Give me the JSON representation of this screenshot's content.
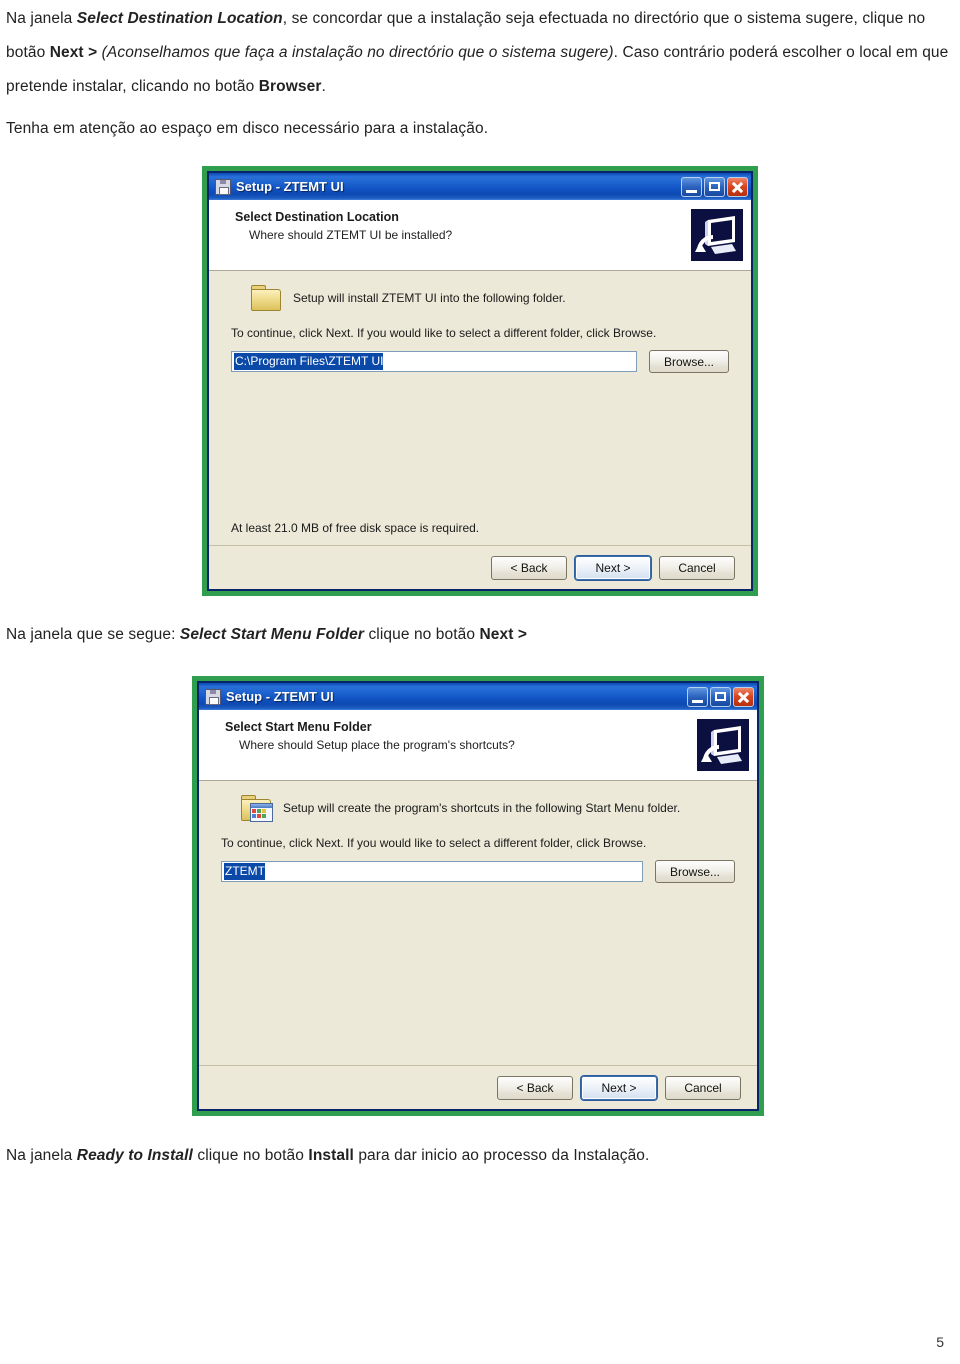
{
  "document": {
    "paragraphs": {
      "intro": {
        "s1": "Na janela ",
        "s2_bold_italic": "Select Destination Location",
        "s3": ", se concordar que a instalação seja efectuada no directório que o sistema sugere, clique no botão ",
        "s4_bold": "Next >",
        "s5_italic": " (Aconselhamos que faça a instalação no directório que o sistema sugere)",
        "s6": ". Caso contrário poderá escolher o local em que pretende instalar, clicando no botão ",
        "s7_bold": "Browser",
        "s8": "."
      },
      "disk": {
        "s1": "Tenha em atenção ao espaço em disco necessário para a instalação."
      },
      "menu": {
        "s1": "Na janela que se segue: ",
        "s2_bold_italic": "Select Start Menu Folder",
        "s3": "  clique no botão ",
        "s4_bold": "Next >"
      },
      "ready": {
        "s1": "Na janela  ",
        "s2_bold_italic": "Ready to Install",
        "s3": " clique no botão ",
        "s4_bold": "Install",
        "s5": " para dar inicio ao processo da Instalação."
      }
    },
    "page_number": "5"
  },
  "colors": {
    "capture_frame_green": "#2f9e4f",
    "window_border_navy": "#0a246a",
    "titlebar_blue": "#1153c4",
    "dialog_background": "#ece9d8",
    "selection_blue": "#0a49a8",
    "close_button_red": "#da4720",
    "header_art_navy": "#0b1040"
  },
  "dialogs": [
    {
      "id": "select-destination-location",
      "titlebar": {
        "icon": "setup-disk-icon",
        "title": "Setup - ZTEMT UI",
        "buttons": [
          {
            "name": "minimize-button",
            "glyph": "minimize-icon"
          },
          {
            "name": "maximize-button",
            "glyph": "maximize-icon"
          },
          {
            "name": "close-button",
            "glyph": "close-icon"
          }
        ]
      },
      "header": {
        "title": "Select Destination Location",
        "subtitle": "Where should ZTEMT UI be installed?",
        "art": "computer-monitor-icon"
      },
      "body": {
        "folder_icon": "folder-icon",
        "info_text": "Setup will install ZTEMT UI into the following folder.",
        "continue_text": "To continue, click Next. If you would like to select a different folder, click Browse.",
        "path_input": {
          "name": "destination-path-input",
          "value": "C:\\Program Files\\ZTEMT UI",
          "selected": true
        },
        "browse_label": "Browse...",
        "disk_note": "At least 21.0 MB of free disk space is required."
      },
      "footer": {
        "back_label": "< Back",
        "next_label": "Next >",
        "cancel_label": "Cancel",
        "focused": "next"
      }
    },
    {
      "id": "select-start-menu-folder",
      "titlebar": {
        "icon": "setup-disk-icon",
        "title": "Setup - ZTEMT UI",
        "buttons": [
          {
            "name": "minimize-button",
            "glyph": "minimize-icon"
          },
          {
            "name": "maximize-button",
            "glyph": "maximize-icon"
          },
          {
            "name": "close-button",
            "glyph": "close-icon"
          }
        ]
      },
      "header": {
        "title": "Select Start Menu Folder",
        "subtitle": "Where should Setup place the program's shortcuts?",
        "art": "computer-monitor-icon"
      },
      "body": {
        "folder_icon": "folder-start-menu-icon",
        "info_text": "Setup will create the program's shortcuts in the following Start Menu folder.",
        "continue_text": "To continue, click Next. If you would like to select a different folder, click Browse.",
        "path_input": {
          "name": "start-menu-folder-input",
          "value": "ZTEMT",
          "selected": true
        },
        "browse_label": "Browse...",
        "disk_note": ""
      },
      "footer": {
        "back_label": "< Back",
        "next_label": "Next >",
        "cancel_label": "Cancel",
        "focused": "next"
      }
    }
  ]
}
